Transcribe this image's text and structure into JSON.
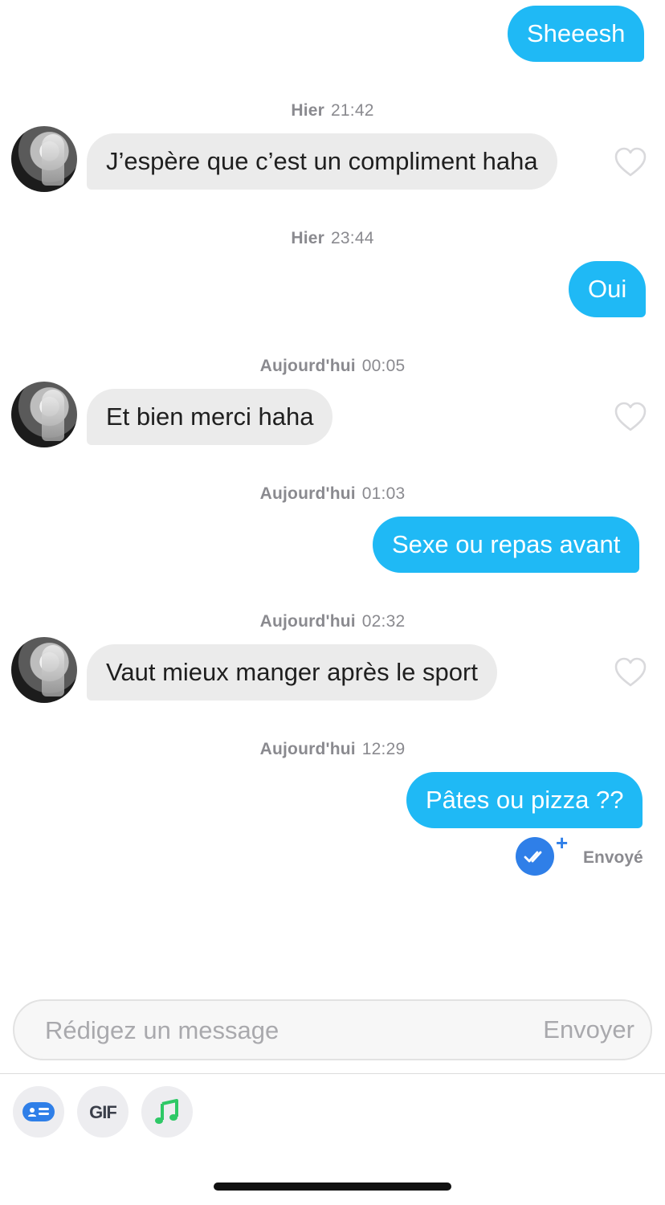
{
  "thread": {
    "messages": [
      {
        "dir": "out",
        "text": "Sheeesh"
      },
      {
        "day": "Hier",
        "time": "21:42",
        "dir": "in",
        "text": "J’espère que c’est un compliment haha"
      },
      {
        "day": "Hier",
        "time": "23:44",
        "dir": "out",
        "text": "Oui"
      },
      {
        "day": "Aujourd'hui",
        "time": "00:05",
        "dir": "in",
        "text": "Et bien merci haha"
      },
      {
        "day": "Aujourd'hui",
        "time": "01:03",
        "dir": "out",
        "text": "Sexe ou repas avant"
      },
      {
        "day": "Aujourd'hui",
        "time": "02:32",
        "dir": "in",
        "text": "Vaut mieux manger après le sport"
      },
      {
        "day": "Aujourd'hui",
        "time": "12:29",
        "dir": "out",
        "text": "Pâtes ou pizza ??"
      }
    ],
    "status": {
      "text": "Envoyé",
      "plus": "+"
    }
  },
  "composer": {
    "placeholder": "Rédigez un message",
    "send_label": "Envoyer"
  },
  "toolbar": {
    "gif_label": "GIF"
  },
  "colors": {
    "outgoing_bubble": "#1fb9f5",
    "incoming_bubble": "#ebebeb",
    "read_check": "#2f7fe8",
    "music_icon": "#2ec866"
  },
  "icons": [
    "heart-outline-icon",
    "double-check-icon",
    "plus-icon",
    "id-card-icon",
    "gif-icon",
    "music-note-icon"
  ]
}
